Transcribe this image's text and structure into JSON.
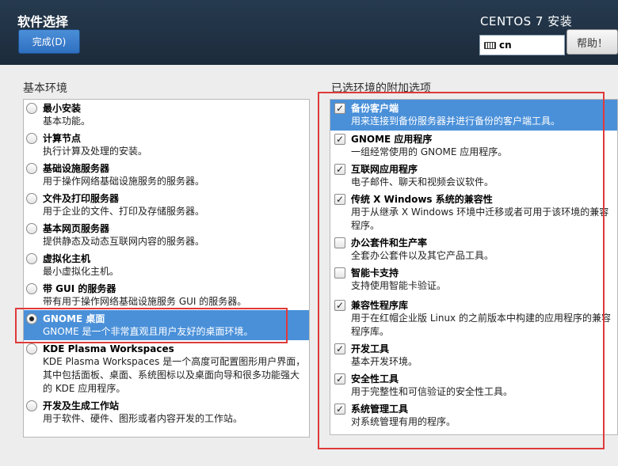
{
  "header": {
    "page_title": "软件选择",
    "done_label": "完成(D)",
    "product": "CENTOS 7 安装",
    "keyboard_layout": "cn",
    "help_label": "帮助！"
  },
  "base_env": {
    "label": "基本环境",
    "items": [
      {
        "title": "最小安装",
        "desc": "基本功能。",
        "selected": false
      },
      {
        "title": "计算节点",
        "desc": "执行计算及处理的安装。",
        "selected": false
      },
      {
        "title": "基础设施服务器",
        "desc": "用于操作网络基础设施服务的服务器。",
        "selected": false
      },
      {
        "title": "文件及打印服务器",
        "desc": "用于企业的文件、打印及存储服务器。",
        "selected": false
      },
      {
        "title": "基本网页服务器",
        "desc": "提供静态及动态互联网内容的服务器。",
        "selected": false
      },
      {
        "title": "虚拟化主机",
        "desc": "最小虚拟化主机。",
        "selected": false
      },
      {
        "title": "带 GUI 的服务器",
        "desc": "带有用于操作网络基础设施服务 GUI 的服务器。",
        "selected": false
      },
      {
        "title": "GNOME 桌面",
        "desc": "GNOME 是一个非常直观且用户友好的桌面环境。",
        "selected": true
      },
      {
        "title": "KDE Plasma Workspaces",
        "desc": "KDE Plasma Workspaces 是一个高度可配置图形用户界面，其中包括面板、桌面、系统图标以及桌面向导和很多功能强大的 KDE 应用程序。",
        "selected": false
      },
      {
        "title": "开发及生成工作站",
        "desc": "用于软件、硬件、图形或者内容开发的工作站。",
        "selected": false
      }
    ]
  },
  "addons": {
    "label": "已选环境的附加选项",
    "items": [
      {
        "title": "备份客户端",
        "desc": "用来连接到备份服务器并进行备份的客户端工具。",
        "checked": true,
        "highlighted": true
      },
      {
        "title": "GNOME 应用程序",
        "desc": "一组经常使用的 GNOME 应用程序。",
        "checked": true,
        "highlighted": false
      },
      {
        "title": "互联网应用程序",
        "desc": "电子邮件、聊天和视频会议软件。",
        "checked": true,
        "highlighted": false
      },
      {
        "title": "传统 X Windows 系统的兼容性",
        "desc": "用于从继承 X Windows 环境中迁移或者可用于该环境的兼容程序。",
        "checked": true,
        "highlighted": false
      },
      {
        "title": "办公套件和生产率",
        "desc": "全套办公套件以及其它产品工具。",
        "checked": false,
        "highlighted": false
      },
      {
        "title": "智能卡支持",
        "desc": "支持使用智能卡验证。",
        "checked": false,
        "highlighted": false
      },
      {
        "title": "兼容性程序库",
        "desc": "用于在红帽企业版 Linux 的之前版本中构建的应用程序的兼容程序库。",
        "checked": true,
        "highlighted": false
      },
      {
        "title": "开发工具",
        "desc": "基本开发环境。",
        "checked": true,
        "highlighted": false
      },
      {
        "title": "安全性工具",
        "desc": "用于完整性和可信验证的安全性工具。",
        "checked": true,
        "highlighted": false
      },
      {
        "title": "系统管理工具",
        "desc": "对系统管理有用的程序。",
        "checked": true,
        "highlighted": false
      }
    ]
  },
  "colors": {
    "header_bg": "#1f2f40",
    "selection_bg": "#4a90d9",
    "annotation_red": "#e03a3a"
  }
}
